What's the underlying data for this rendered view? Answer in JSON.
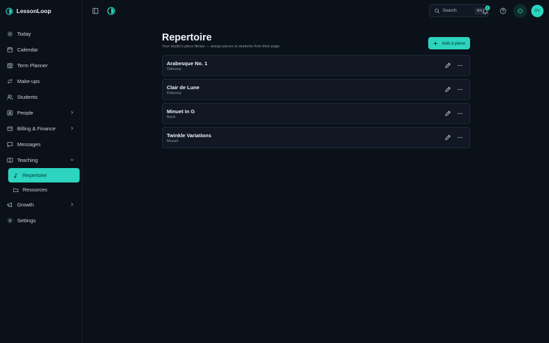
{
  "app": {
    "name": "LessonLoop"
  },
  "sidebar": {
    "items": [
      {
        "label": "Today",
        "icon": "sun-icon"
      },
      {
        "label": "Calendar",
        "icon": "calendar-icon"
      },
      {
        "label": "Term Planner",
        "icon": "calendar-grid-icon"
      },
      {
        "label": "Make-ups",
        "icon": "swap-icon"
      },
      {
        "label": "Students",
        "icon": "users-icon"
      },
      {
        "label": "People",
        "icon": "contact-icon",
        "expandable": true
      },
      {
        "label": "Billing & Finance",
        "icon": "wallet-icon",
        "expandable": true
      },
      {
        "label": "Messages",
        "icon": "message-icon"
      },
      {
        "label": "Teaching",
        "icon": "book-icon",
        "expanded": true
      },
      {
        "label": "Repertoire",
        "icon": "music-note-icon",
        "active": true
      },
      {
        "label": "Resources",
        "icon": "folder-icon"
      },
      {
        "label": "Growth",
        "icon": "megaphone-icon",
        "expandable": true
      },
      {
        "label": "Settings",
        "icon": "gear-icon"
      }
    ]
  },
  "topbar": {
    "search_label": "Search",
    "search_shortcut": "⌘K",
    "notification_count": "0",
    "avatar_initials": "DV"
  },
  "page": {
    "title": "Repertoire",
    "subtitle": "Your studio's piece library — assign pieces to students from their page.",
    "add_button": "Add a piece"
  },
  "pieces": [
    {
      "title": "Arabesque No. 1",
      "composer": "Debussy"
    },
    {
      "title": "Clair de Lune",
      "composer": "Debussy"
    },
    {
      "title": "Minuet in G",
      "composer": "Bach"
    },
    {
      "title": "Twinkle Variations",
      "composer": "Mozart"
    }
  ],
  "colors": {
    "accent": "#2dd4bf",
    "background": "#0b1119",
    "card": "#111824"
  }
}
